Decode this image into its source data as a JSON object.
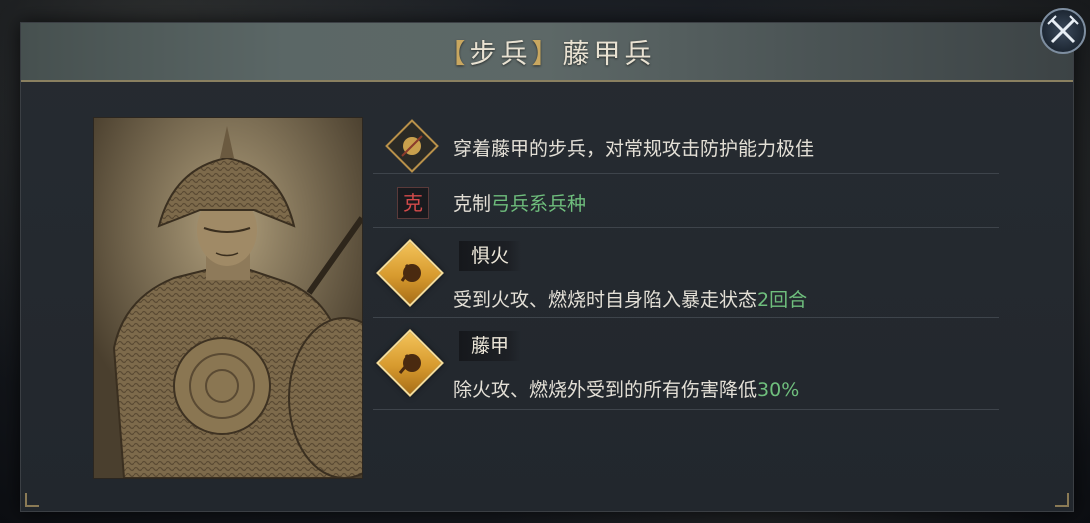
{
  "dialog": {
    "title_bracket_open": "【",
    "title_category": "步兵",
    "title_bracket_close": "】",
    "title_name": "藤甲兵"
  },
  "traits": {
    "description": "穿着藤甲的步兵，对常规攻击防护能力极佳",
    "counter_badge": "克",
    "counter_prefix": "克制",
    "counter_target": "弓兵系兵种"
  },
  "skills": [
    {
      "name": "惧火",
      "desc_prefix": "受到火攻、燃烧时自身陷入暴走状态",
      "desc_value": "2回合"
    },
    {
      "name": "藤甲",
      "desc_prefix": "除火攻、燃烧外受到的所有伤害降低",
      "desc_value": "30%"
    }
  ],
  "icons": {
    "close": "close-x-icon",
    "description": "rattan-shield-icon",
    "counter": "counter-ke-icon",
    "skill_1": "fire-fear-icon",
    "skill_2": "rattan-armor-icon"
  },
  "colors": {
    "highlight": "#6fbf7d",
    "title_text": "#e9e2d2",
    "skill_badge": "#e2a63e"
  }
}
